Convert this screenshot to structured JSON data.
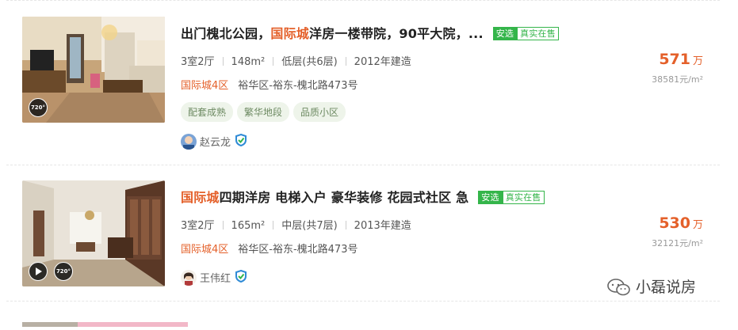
{
  "listings": [
    {
      "title_parts": [
        "出门槐北公园，",
        "国际城",
        "洋房一楼带院，90平大院，..."
      ],
      "tags": [
        "安选",
        "真实在售"
      ],
      "info": [
        "3室2厅",
        "148m²",
        "低层(共6层)",
        "2012年建造"
      ],
      "community": "国际城4区",
      "address": "裕华区-裕东-槐北路473号",
      "chips": [
        "配套成熟",
        "繁华地段",
        "品质小区"
      ],
      "agent": "赵云龙",
      "price_total": "571",
      "price_unit": "万",
      "price_per": "38581元/m²",
      "badge": "720°"
    },
    {
      "title_parts": [
        "国际城",
        "四期洋房 电梯入户 豪华装修 花园式社区 急"
      ],
      "tags": [
        "安选",
        "真实在售"
      ],
      "info": [
        "3室2厅",
        "165m²",
        "中层(共7层)",
        "2013年建造"
      ],
      "community": "国际城4区",
      "address": "裕华区-裕东-槐北路473号",
      "agent": "王伟红",
      "price_total": "530",
      "price_unit": "万",
      "price_per": "32121元/m²",
      "badge": "720°"
    }
  ],
  "watermark": "小磊说房",
  "colors": {
    "accent": "#e4602a",
    "green": "#34b54a",
    "chip_bg": "#eef4ea"
  },
  "icons": [
    "vr-720-icon",
    "play-icon",
    "shield-icon",
    "wechat-icon"
  ]
}
